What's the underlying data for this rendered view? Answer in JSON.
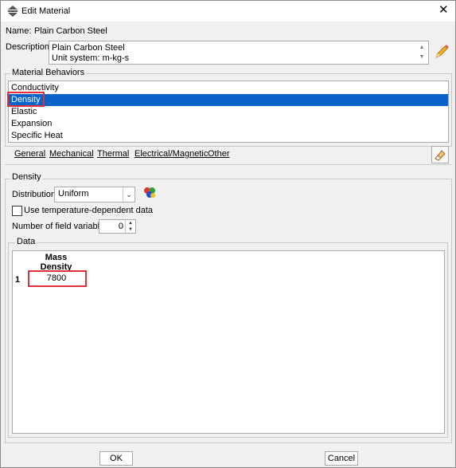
{
  "window": {
    "title": "Edit Material",
    "close_glyph": "✕"
  },
  "name": {
    "label": "Name:",
    "value": "Plain Carbon Steel"
  },
  "description": {
    "label": "Description:",
    "line1": "Plain Carbon Steel",
    "line2": "Unit system: m-kg-s"
  },
  "material_behaviors": {
    "title": "Material Behaviors",
    "items": [
      "Conductivity",
      "Density",
      "Elastic",
      "Expansion",
      "Specific Heat"
    ],
    "selected": "Density"
  },
  "menu": {
    "general": "General",
    "mechanical": "Mechanical",
    "thermal": "Thermal",
    "electrical": "Electrical/Magnetic",
    "other": "Other"
  },
  "density": {
    "title": "Density",
    "distribution_label": "Distribution:",
    "distribution_value": "Uniform",
    "temp_dependent_label": "Use temperature-dependent data",
    "temp_dependent_checked": false,
    "field_vars_label": "Number of field variables:",
    "field_vars_value": "0"
  },
  "data_table": {
    "title": "Data",
    "header_line1": "Mass",
    "header_line2": "Density",
    "rows": [
      {
        "index": "1",
        "mass_density": "7800"
      }
    ]
  },
  "buttons": {
    "ok": "OK",
    "cancel": "Cancel"
  },
  "colors": {
    "selection": "#0a63c8",
    "highlight_box": "#e0303a"
  },
  "icons": [
    "app-icon",
    "close-icon",
    "pencil-icon",
    "eraser-icon",
    "multicolor-sphere-icon",
    "chevron-down-icon",
    "spin-up-icon",
    "spin-down-icon"
  ]
}
